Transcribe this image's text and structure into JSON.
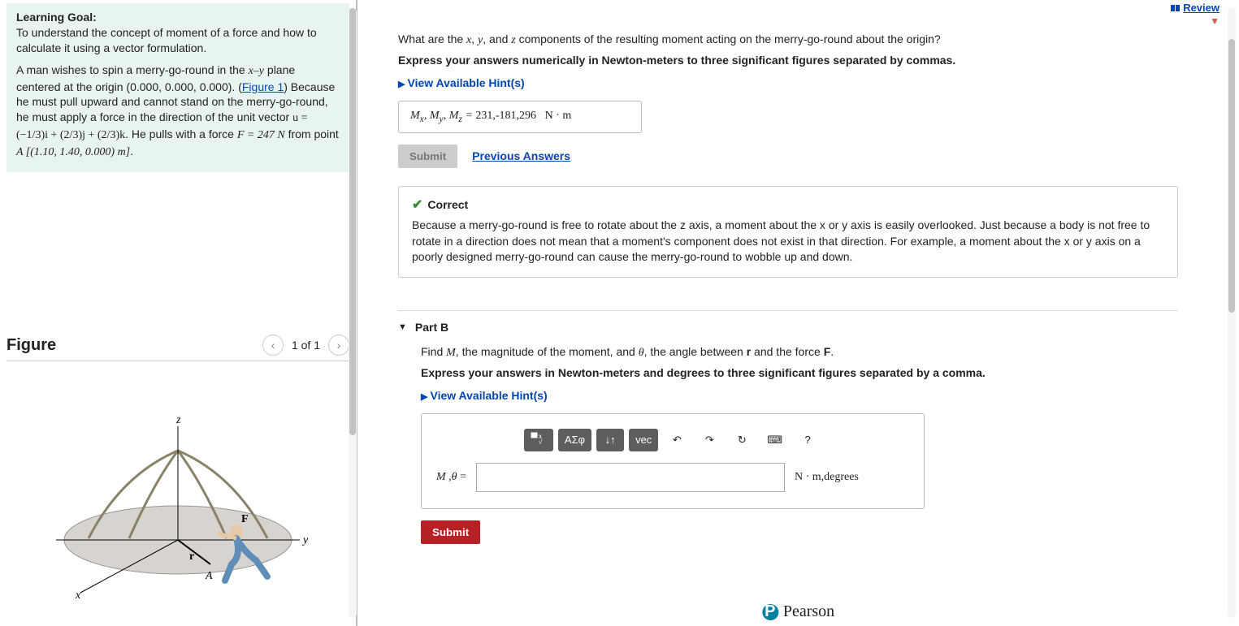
{
  "review_link": "Review",
  "left": {
    "goal_title": "Learning Goal:",
    "goal_text": "To understand the concept of moment of a force and how to calculate it using a vector formulation.",
    "problem_p1a": "A man wishes to spin a merry-go-round in the ",
    "problem_p1b": " plane centered at the origin ",
    "origin": "(0.000, 0.000, 0.000)",
    "figure_ref": "Figure 1",
    "problem_p2": " Because he must pull upward and cannot stand on the merry-go-round, he must apply a force in the direction of the unit vector ",
    "u_eq": "u = (−1/3)i + (2/3)j + (2/3)k",
    "problem_p3": ". He pulls with a force ",
    "F_val": "F = 247 N",
    "problem_p4": " from point ",
    "A_pt": "A [(1.10, 1.40, 0.000) m]",
    "figure_title": "Figure",
    "figure_pager": "1 of 1"
  },
  "partA": {
    "question_a": "What are the ",
    "question_b": " components of the resulting moment acting on the merry-go-round about the origin?",
    "instruction": "Express your answers numerically in Newton-meters to three significant figures separated by commas.",
    "hints_label": "View Available Hint(s)",
    "answer_label": "Mₓ, Mᵧ, M_z =",
    "answer_value": "231,-181,296",
    "answer_units": "N · m",
    "submit": "Submit",
    "prev_answers": "Previous Answers",
    "correct_title": "Correct",
    "correct_body": "Because a merry-go-round is free to rotate about the z axis, a moment about the x or y axis is easily overlooked. Just because a body is not free to rotate in a direction does not mean that a moment's component does not exist in that direction. For example, a moment about the x or y axis on a poorly designed merry-go-round can cause the merry-go-round to wobble up and down."
  },
  "partB": {
    "title": "Part B",
    "question": "Find M, the magnitude of the moment, and θ, the angle between r and the force F.",
    "instruction": "Express your answers in Newton-meters and degrees to three significant figures separated by a comma.",
    "hints_label": "View Available Hint(s)",
    "toolbar": {
      "t2": "ΑΣφ",
      "t3": "↓↑",
      "t4": "vec",
      "t5": "↶",
      "t6": "↷",
      "t7": "↻",
      "t8": "⌨",
      "t9": "?"
    },
    "input_label": "M ,θ =",
    "input_value": "",
    "units": "N · m,degrees",
    "submit": "Submit"
  },
  "brand": "Pearson",
  "figure_labels": {
    "x": "x",
    "y": "y",
    "z": "z",
    "A": "A",
    "F": "F",
    "r": "r"
  }
}
